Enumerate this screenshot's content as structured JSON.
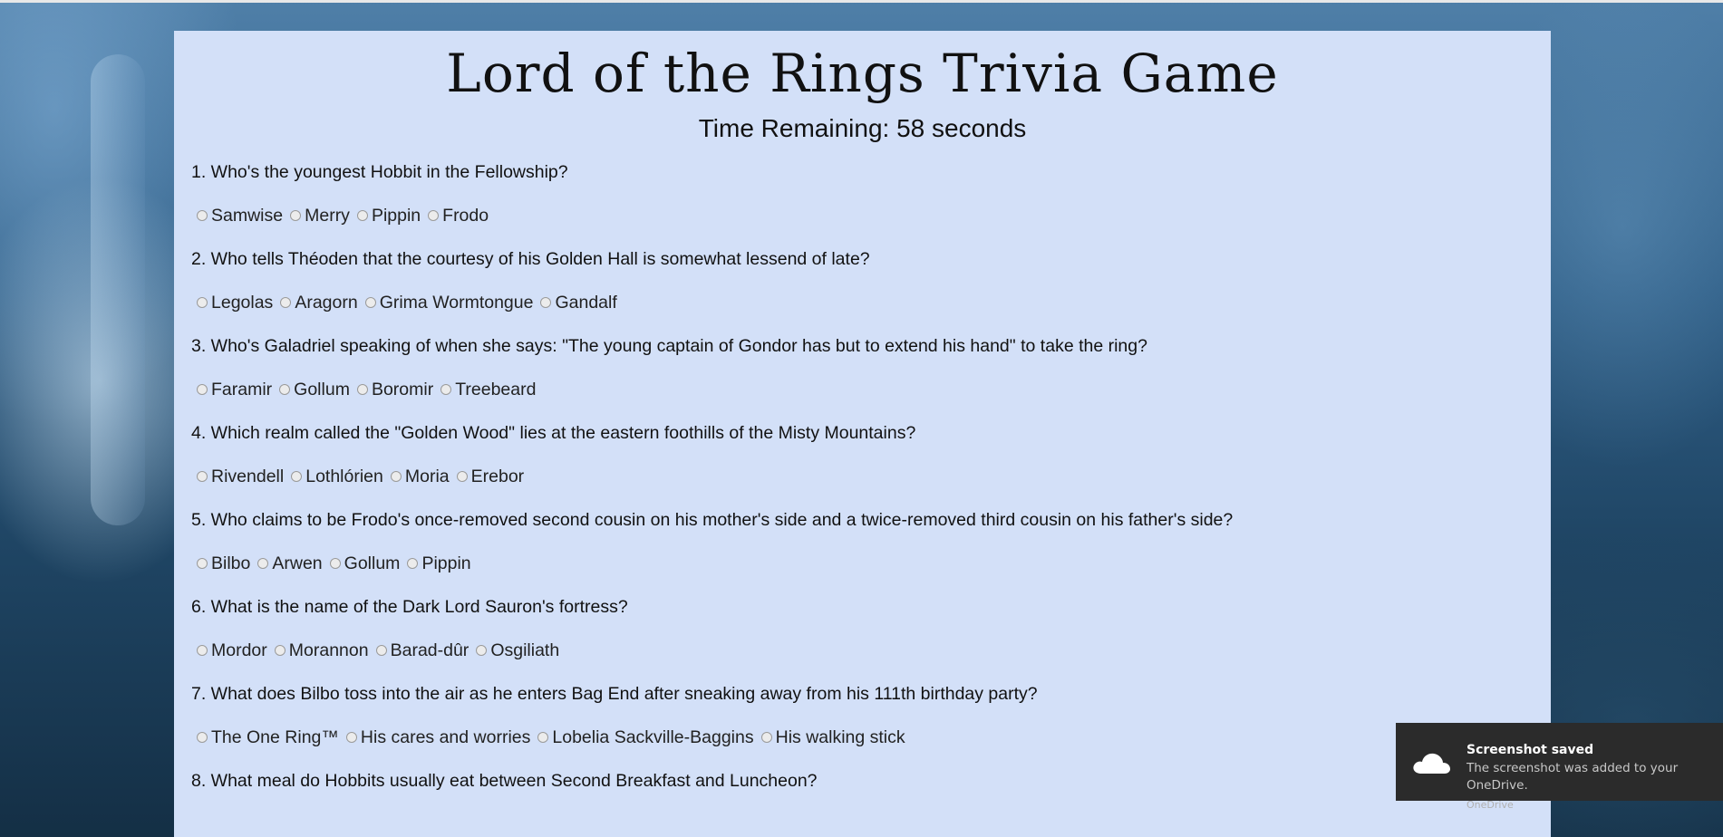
{
  "game": {
    "title": "Lord of the Rings Trivia Game",
    "timer": "Time Remaining: 58 seconds"
  },
  "questions": [
    {
      "text": "1. Who's the youngest Hobbit in the Fellowship?",
      "options": [
        "Samwise",
        "Merry",
        "Pippin",
        "Frodo"
      ]
    },
    {
      "text": "2. Who tells Théoden that the courtesy of his Golden Hall is somewhat lessend of late?",
      "options": [
        "Legolas",
        "Aragorn",
        "Grima Wormtongue",
        "Gandalf"
      ]
    },
    {
      "text": "3. Who's Galadriel speaking of when she says: \"The young captain of Gondor has but to extend his hand\" to take the ring?",
      "options": [
        "Faramir",
        "Gollum",
        "Boromir",
        "Treebeard"
      ]
    },
    {
      "text": "4. Which realm called the \"Golden Wood\" lies at the eastern foothills of the Misty Mountains?",
      "options": [
        "Rivendell",
        "Lothlórien",
        "Moria",
        "Erebor"
      ]
    },
    {
      "text": "5. Who claims to be Frodo's once-removed second cousin on his mother's side and a twice-removed third cousin on his father's side?",
      "options": [
        "Bilbo",
        "Arwen",
        "Gollum",
        "Pippin"
      ]
    },
    {
      "text": "6. What is the name of the Dark Lord Sauron's fortress?",
      "options": [
        "Mordor",
        "Morannon",
        "Barad-dûr",
        "Osgiliath"
      ]
    },
    {
      "text": "7. What does Bilbo toss into the air as he enters Bag End after sneaking away from his 111th birthday party?",
      "options": [
        "The One Ring™",
        "His cares and worries",
        "Lobelia Sackville-Baggins",
        "His walking stick"
      ]
    },
    {
      "text": "8. What meal do Hobbits usually eat between Second Breakfast and Luncheon?",
      "options": []
    }
  ],
  "toast": {
    "title": "Screenshot saved",
    "body": "The screenshot was added to your OneDrive.",
    "source": "OneDrive",
    "icon": "cloud-icon"
  }
}
